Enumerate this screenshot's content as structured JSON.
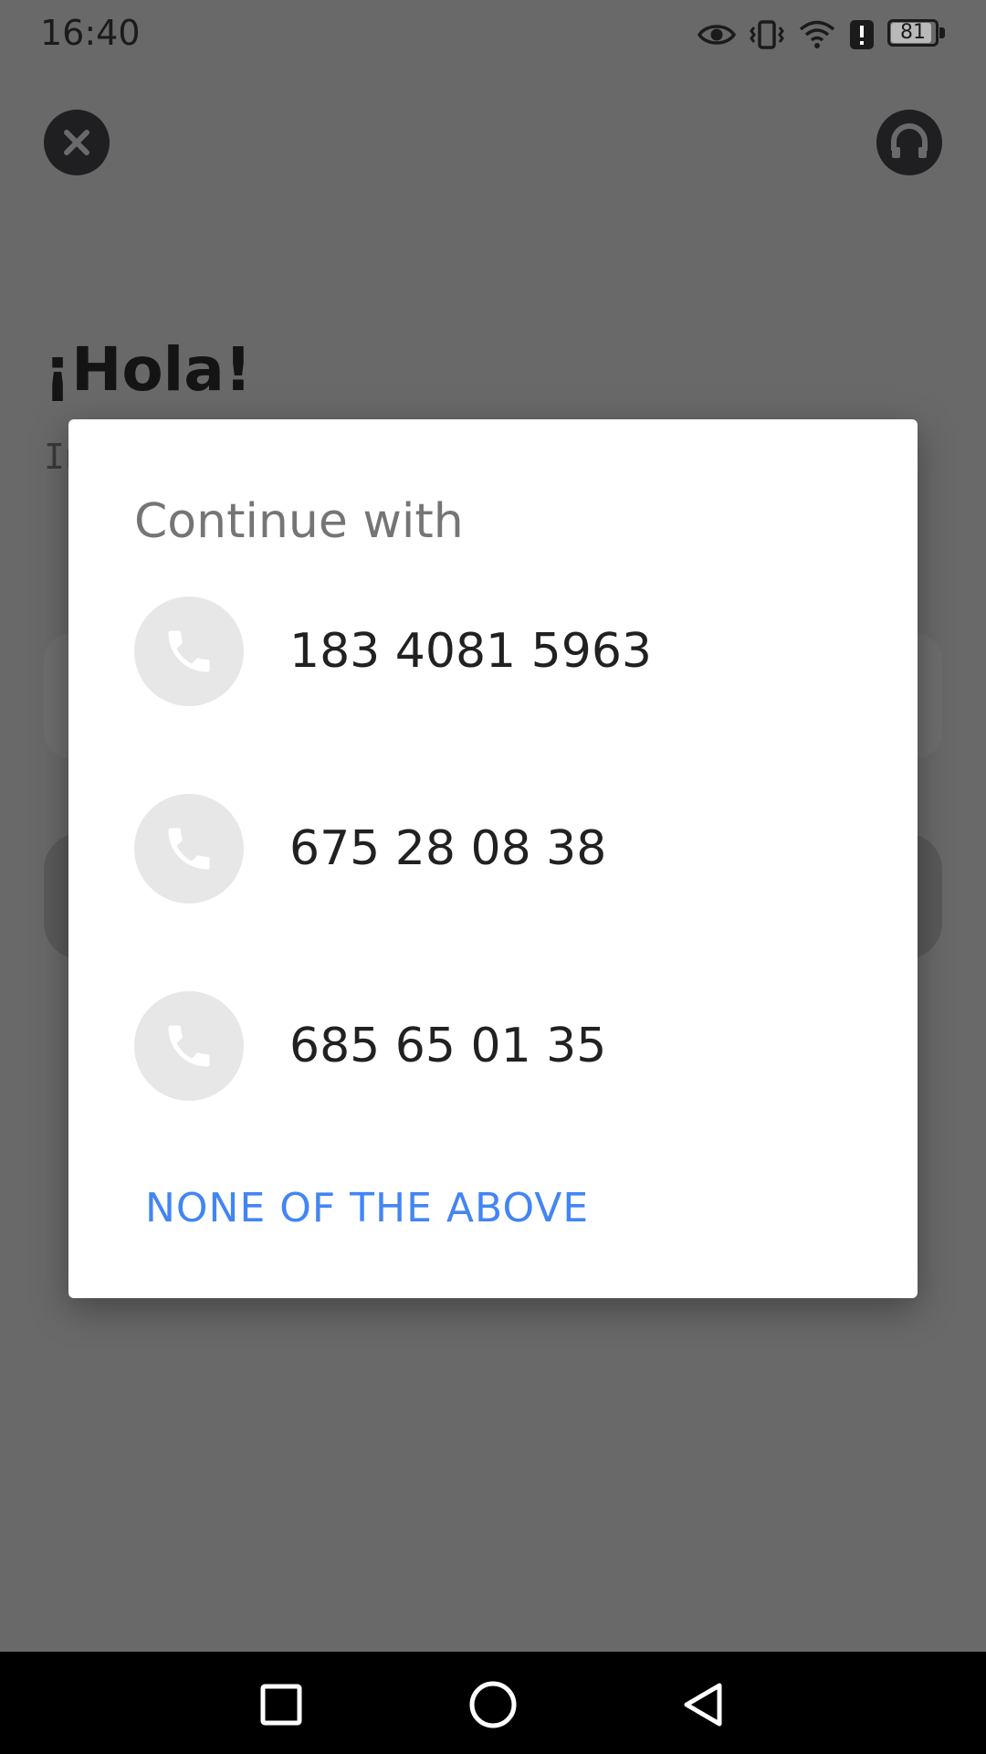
{
  "status_bar": {
    "time": "16:40",
    "battery_level": "81",
    "icons": [
      "eye-icon",
      "vibrate-icon",
      "wifi-icon",
      "alert-icon",
      "battery-icon"
    ]
  },
  "background": {
    "greeting": "¡Hola!",
    "hint_text": "In",
    "close_icon": "close-icon",
    "support_icon": "headset-icon"
  },
  "dialog": {
    "title": "Continue with",
    "options": [
      {
        "number": "183 4081 5963",
        "icon": "phone-icon"
      },
      {
        "number": "675 28 08 38",
        "icon": "phone-icon"
      },
      {
        "number": "685 65 01 35",
        "icon": "phone-icon"
      }
    ],
    "none_label": "NONE OF THE ABOVE"
  },
  "colors": {
    "scrim": "#696969",
    "accent": "#4285f4",
    "dialog_bg": "#ffffff",
    "avatar_bg": "#e7e7e7"
  },
  "nav_bar": {
    "buttons": [
      "recent-apps-icon",
      "home-icon",
      "back-icon"
    ]
  }
}
